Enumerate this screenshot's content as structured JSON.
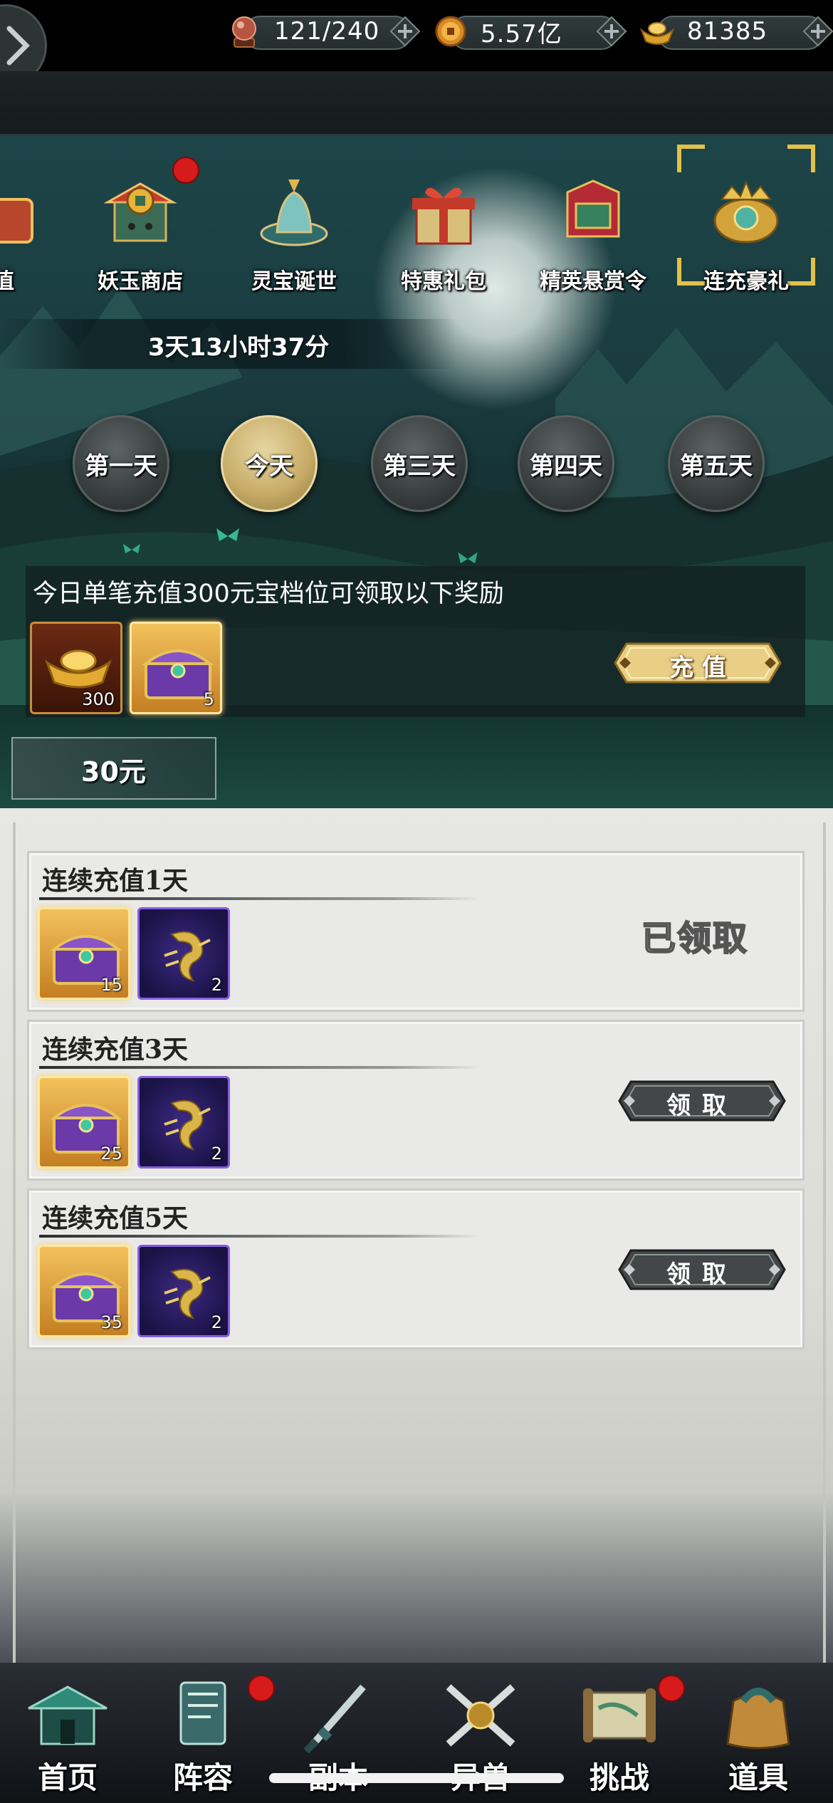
{
  "resources": {
    "stamina": "121/240",
    "coins": "5.57亿",
    "ingots": "81385"
  },
  "event_tabs": [
    {
      "label": "值"
    },
    {
      "label": "妖玉商店"
    },
    {
      "label": "灵宝诞世"
    },
    {
      "label": "特惠礼包"
    },
    {
      "label": "精英悬赏令"
    },
    {
      "label": "连充豪礼"
    }
  ],
  "countdown": "3天13小时37分",
  "days": [
    "第一天",
    "今天",
    "第三天",
    "第四天",
    "第五天"
  ],
  "recharge": {
    "description": "今日单笔充值300元宝档位可领取以下奖励",
    "rewards": [
      {
        "count": "300"
      },
      {
        "count": "5"
      }
    ],
    "button": "充 值",
    "amount": "30元"
  },
  "continuous_rewards": [
    {
      "title": "连续充值1天",
      "rewards": [
        {
          "count": "15"
        },
        {
          "count": "2"
        }
      ],
      "status": "已领取"
    },
    {
      "title": "连续充值3天",
      "rewards": [
        {
          "count": "25"
        },
        {
          "count": "2"
        }
      ],
      "button": "领取"
    },
    {
      "title": "连续充值5天",
      "rewards": [
        {
          "count": "35"
        },
        {
          "count": "2"
        }
      ],
      "button": "领取"
    }
  ],
  "nav": [
    {
      "label": "首页"
    },
    {
      "label": "阵容"
    },
    {
      "label": "副本"
    },
    {
      "label": "异兽"
    },
    {
      "label": "挑战"
    },
    {
      "label": "道具"
    }
  ]
}
